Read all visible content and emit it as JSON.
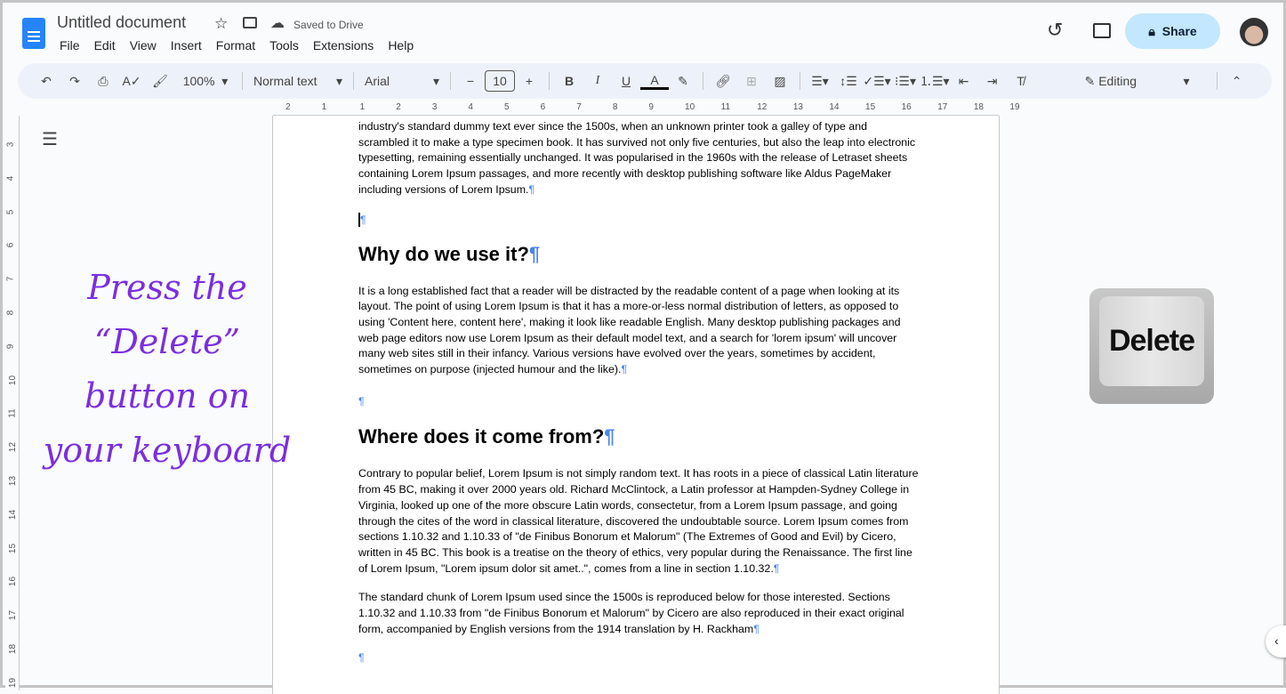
{
  "header": {
    "title": "Untitled document",
    "save_status": "Saved to Drive",
    "share_label": "Share",
    "menu": [
      "File",
      "Edit",
      "View",
      "Insert",
      "Format",
      "Tools",
      "Extensions",
      "Help"
    ]
  },
  "toolbar": {
    "zoom": "100%",
    "style": "Normal text",
    "font": "Arial",
    "font_size": "10",
    "mode": "Editing"
  },
  "ruler": [
    "2",
    "1",
    "1",
    "2",
    "3",
    "4",
    "5",
    "6",
    "7",
    "8",
    "9",
    "10",
    "11",
    "12",
    "13",
    "14",
    "15",
    "16",
    "17",
    "18",
    "19"
  ],
  "vruler": [
    "3",
    "4",
    "5",
    "6",
    "7",
    "8",
    "9",
    "10",
    "11",
    "12",
    "13",
    "14",
    "15",
    "16",
    "17",
    "18",
    "19"
  ],
  "document": {
    "p1": "industry's standard dummy text ever since the 1500s, when an unknown printer took a galley of type and scrambled it to make a type specimen book. It has survived not only five centuries, but also the leap into electronic typesetting, remaining essentially unchanged. It was popularised in the 1960s with the release of Letraset sheets containing Lorem Ipsum passages, and more recently with desktop publishing software like Aldus PageMaker including versions of Lorem Ipsum.",
    "h1": "Why do we use it?",
    "p2": "It is a long established fact that a reader will be distracted by the readable content of a page when looking at its layout. The point of using Lorem Ipsum is that it has a more-or-less normal distribution of letters, as opposed to using 'Content here, content here', making it look like readable English. Many desktop publishing packages and web page editors now use Lorem Ipsum as their default model text, and a search for 'lorem ipsum' will uncover many web sites still in their infancy. Various versions have evolved over the years, sometimes by accident, sometimes on purpose (injected humour and the like).",
    "h2": "Where does it come from?",
    "p3": "Contrary to popular belief, Lorem Ipsum is not simply random text. It has roots in a piece of classical Latin literature from 45 BC, making it over 2000 years old. Richard McClintock, a Latin professor at Hampden-Sydney College in Virginia, looked up one of the more obscure Latin words, consectetur, from a Lorem Ipsum passage, and going through the cites of the word in classical literature, discovered the undoubtable source. Lorem Ipsum comes from sections 1.10.32 and 1.10.33 of \"de Finibus Bonorum et Malorum\" (The Extremes of Good and Evil) by Cicero, written in 45 BC. This book is a treatise on the theory of ethics, very popular during the Renaissance. The first line of Lorem Ipsum, \"Lorem ipsum dolor sit amet..\", comes from a line in section 1.10.32.",
    "p4": "The standard chunk of Lorem Ipsum used since the 1500s is reproduced below for those interested. Sections 1.10.32 and 1.10.33 from \"de Finibus Bonorum et Malorum\" by Cicero are also reproduced in their exact original form, accompanied by English versions from the 1914 translation by H. Rackham",
    "pilcrow": "¶"
  },
  "overlay": {
    "instruction": [
      "Press the",
      "“Delete”",
      "button on",
      "your keyboard"
    ],
    "key_label": "Delete"
  },
  "colors": {
    "accent": "#1a73e8",
    "share_bg": "#c2e7ff",
    "instruction": "#7a2ee0"
  }
}
